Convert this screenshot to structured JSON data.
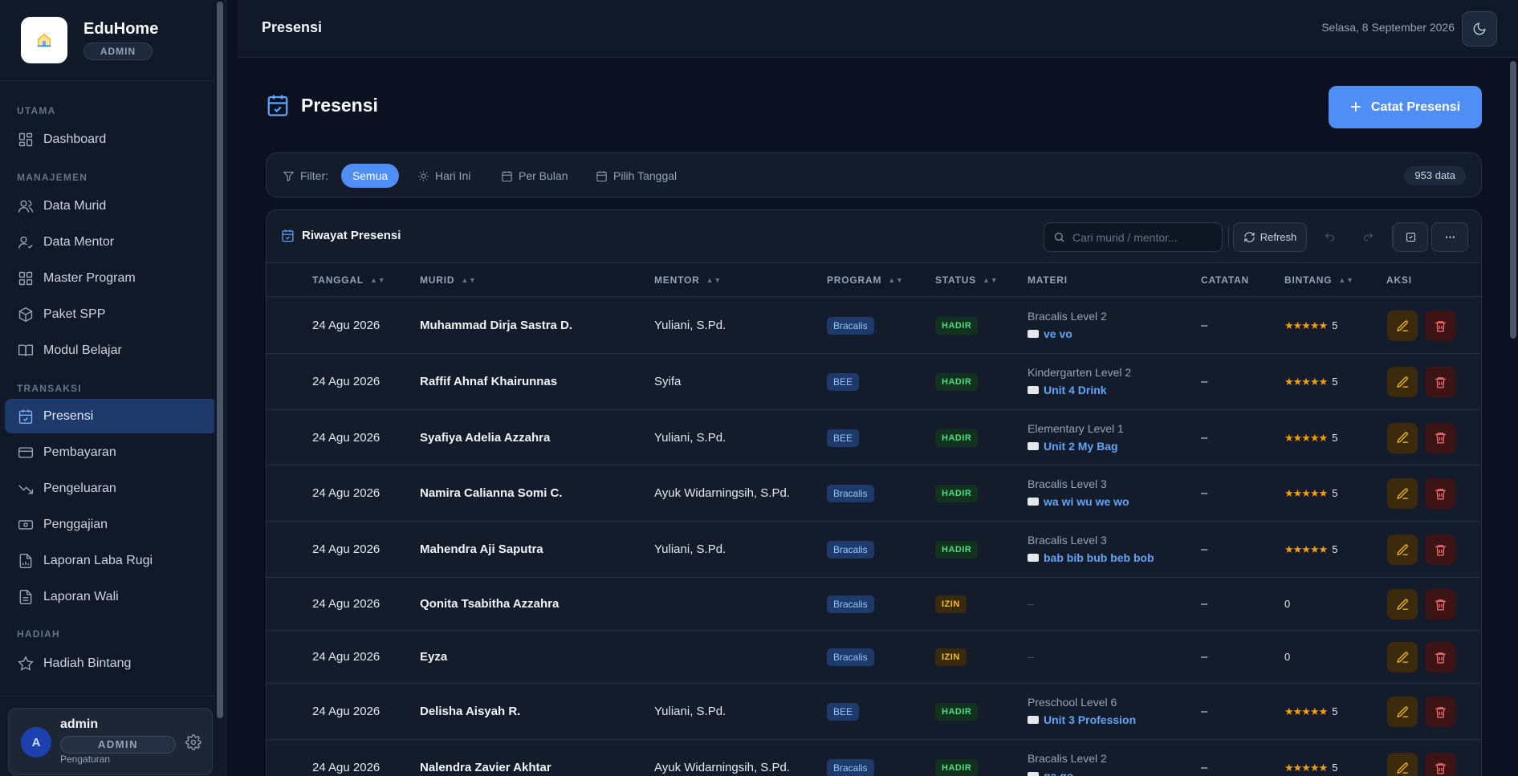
{
  "brand": {
    "name": "EduHome",
    "role": "ADMIN"
  },
  "sidebar": {
    "sections": [
      {
        "label": "UTAMA"
      },
      {
        "label": "MANAJEMEN"
      },
      {
        "label": "TRANSAKSI"
      },
      {
        "label": "HADIAH"
      }
    ],
    "items": [
      {
        "label": "Dashboard",
        "icon": "dashboard-icon"
      },
      {
        "label": "Data Murid",
        "icon": "users-icon"
      },
      {
        "label": "Data Mentor",
        "icon": "user-check-icon"
      },
      {
        "label": "Master Program",
        "icon": "grid-icon"
      },
      {
        "label": "Paket SPP",
        "icon": "package-icon"
      },
      {
        "label": "Modul Belajar",
        "icon": "book-open-icon"
      },
      {
        "label": "Presensi",
        "icon": "calendar-check-icon",
        "active": true
      },
      {
        "label": "Pembayaran",
        "icon": "credit-card-icon"
      },
      {
        "label": "Pengeluaran",
        "icon": "trending-down-icon"
      },
      {
        "label": "Penggajian",
        "icon": "cash-icon"
      },
      {
        "label": "Laporan Laba Rugi",
        "icon": "file-chart-icon"
      },
      {
        "label": "Laporan Wali",
        "icon": "file-text-icon"
      },
      {
        "label": "Hadiah Bintang",
        "icon": "star-icon"
      }
    ]
  },
  "user": {
    "avatar": "A",
    "name": "admin",
    "role": "ADMIN",
    "settings": "Pengaturan"
  },
  "topbar": {
    "title": "Presensi",
    "date": "Selasa, 8 September 2026"
  },
  "page": {
    "title": "Presensi",
    "add_button": "Catat Presensi"
  },
  "filter": {
    "label": "Filter:",
    "options": [
      "Semua",
      "Hari Ini",
      "Per Bulan",
      "Pilih Tanggal"
    ],
    "active": "Semua",
    "count": "953 data"
  },
  "table": {
    "title": "Riwayat Presensi",
    "search_placeholder": "Cari murid / mentor...",
    "refresh_label": "Refresh",
    "columns": [
      "TANGGAL",
      "MURID",
      "MENTOR",
      "PROGRAM",
      "STATUS",
      "MATERI",
      "CATATAN",
      "BINTANG",
      "AKSI"
    ],
    "rows": [
      {
        "date": "24 Agu 2026",
        "student": "Muhammad Dirja Sastra D.",
        "mentor": "Yuliani, S.Pd.",
        "program": "Bracalis",
        "status": "HADIR",
        "level": "Bracalis Level 2",
        "lesson": "ve vo",
        "note": "–",
        "stars": "★★★★★",
        "star_count": "5"
      },
      {
        "date": "24 Agu 2026",
        "student": "Raffif Ahnaf Khairunnas",
        "mentor": "Syifa",
        "program": "BEE",
        "status": "HADIR",
        "level": "Kindergarten Level 2",
        "lesson": "Unit 4 Drink",
        "note": "–",
        "stars": "★★★★★",
        "star_count": "5"
      },
      {
        "date": "24 Agu 2026",
        "student": "Syafiya Adelia Azzahra",
        "mentor": "Yuliani, S.Pd.",
        "program": "BEE",
        "status": "HADIR",
        "level": "Elementary Level 1",
        "lesson": "Unit 2 My Bag",
        "note": "–",
        "stars": "★★★★★",
        "star_count": "5"
      },
      {
        "date": "24 Agu 2026",
        "student": "Namira Calianna Somi C.",
        "mentor": "Ayuk Widarningsih, S.Pd.",
        "program": "Bracalis",
        "status": "HADIR",
        "level": "Bracalis Level 3",
        "lesson": "wa wi wu we wo",
        "note": "–",
        "stars": "★★★★★",
        "star_count": "5"
      },
      {
        "date": "24 Agu 2026",
        "student": "Mahendra Aji Saputra",
        "mentor": "Yuliani, S.Pd.",
        "program": "Bracalis",
        "status": "HADIR",
        "level": "Bracalis Level 3",
        "lesson": "bab bib bub beb bob",
        "note": "–",
        "stars": "★★★★★",
        "star_count": "5"
      },
      {
        "date": "24 Agu 2026",
        "student": "Qonita Tsabitha Azzahra",
        "mentor": "",
        "program": "Bracalis",
        "status": "IZIN",
        "level": "–",
        "lesson": "",
        "note": "–",
        "stars": "",
        "star_count": "0"
      },
      {
        "date": "24 Agu 2026",
        "student": "Eyza",
        "mentor": "",
        "program": "Bracalis",
        "status": "IZIN",
        "level": "–",
        "lesson": "",
        "note": "–",
        "stars": "",
        "star_count": "0"
      },
      {
        "date": "24 Agu 2026",
        "student": "Delisha Aisyah R.",
        "mentor": "Yuliani, S.Pd.",
        "program": "BEE",
        "status": "HADIR",
        "level": "Preschool Level 6",
        "lesson": "Unit 3 Profession",
        "note": "–",
        "stars": "★★★★★",
        "star_count": "5"
      },
      {
        "date": "24 Agu 2026",
        "student": "Nalendra Zavier Akhtar",
        "mentor": "Ayuk Widarningsih, S.Pd.",
        "program": "Bracalis",
        "status": "HADIR",
        "level": "Bracalis Level 2",
        "lesson": "ga go",
        "note": "–",
        "stars": "★★★★★",
        "star_count": "5"
      }
    ]
  },
  "colors": {
    "accent": "#4f8ff5",
    "active_nav": "#1e3a6b",
    "hadir": "#4ade80",
    "izin": "#fbbf24",
    "star": "#f59e0b"
  }
}
